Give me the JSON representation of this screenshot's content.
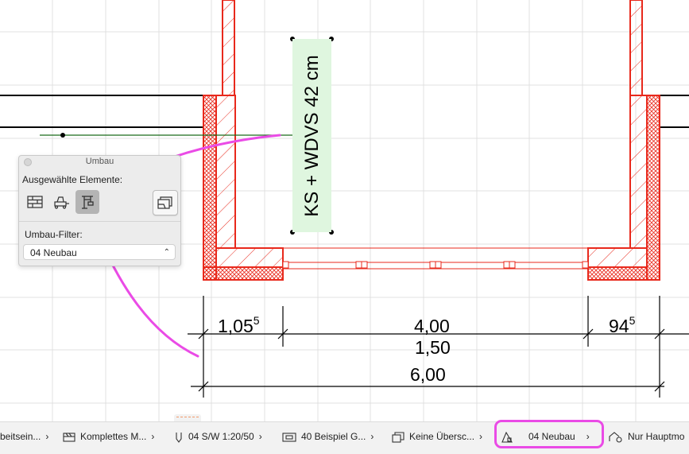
{
  "colors": {
    "wall_red": "#e8291c",
    "pink": "#ea4be6",
    "green_line": "#1a6a1a",
    "label_bg": "#dff6df"
  },
  "palette": {
    "title": "Umbau",
    "selected_label": "Ausgewählte Elemente:",
    "filter_label": "Umbau-Filter:",
    "filter_value": "04 Neubau",
    "icons": [
      "bricks-icon",
      "demolish-icon",
      "new-construction-icon",
      "overrides-icon"
    ]
  },
  "drawing": {
    "wall_label": "KS + WDVS 42 cm",
    "dims": {
      "d1": "1,05",
      "d1_sup": "5",
      "d2": "4,00",
      "d3": "94",
      "d3_sup": "5",
      "d4": "1,50",
      "d5": "6,00"
    }
  },
  "statusbar": {
    "items": [
      {
        "label": "beitsein...",
        "icon": "layer-icon"
      },
      {
        "label": "Komplettes M...",
        "icon": "model-view-icon"
      },
      {
        "label": "04 S/W 1:20/50",
        "icon": "pen-set-icon"
      },
      {
        "label": "40 Beispiel G...",
        "icon": "graphic-override-icon"
      },
      {
        "label": "Keine Übersc...",
        "icon": "override-icon"
      },
      {
        "label": "04 Neubau",
        "icon": "renovation-filter-icon"
      },
      {
        "label": "Nur Hauptmo",
        "icon": "structural-icon"
      }
    ]
  }
}
